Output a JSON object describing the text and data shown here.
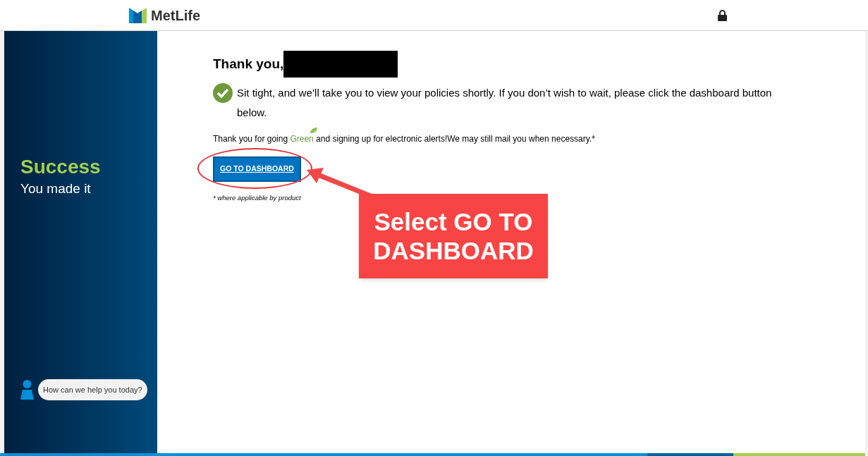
{
  "header": {
    "logo_text": "MetLife"
  },
  "sidebar": {
    "title": "Success",
    "subtitle": "You made it",
    "chat_prompt": "How can we help you today?"
  },
  "content": {
    "heading": "Thank you,",
    "message": "Sit tight, and we’ll take you to view your policies shortly. If you don’t wish to wait, please click the dashboard button below.",
    "note_before": "Thank you for going ",
    "note_highlight": "Green",
    "note_after": "and signing up for electronic alerts!We may still mail you when necessary.*",
    "button": "GO TO DASHBOARD",
    "footnote": "* where applicable by product"
  },
  "annotation": {
    "callout": "Select GO TO DASHBOARD"
  }
}
